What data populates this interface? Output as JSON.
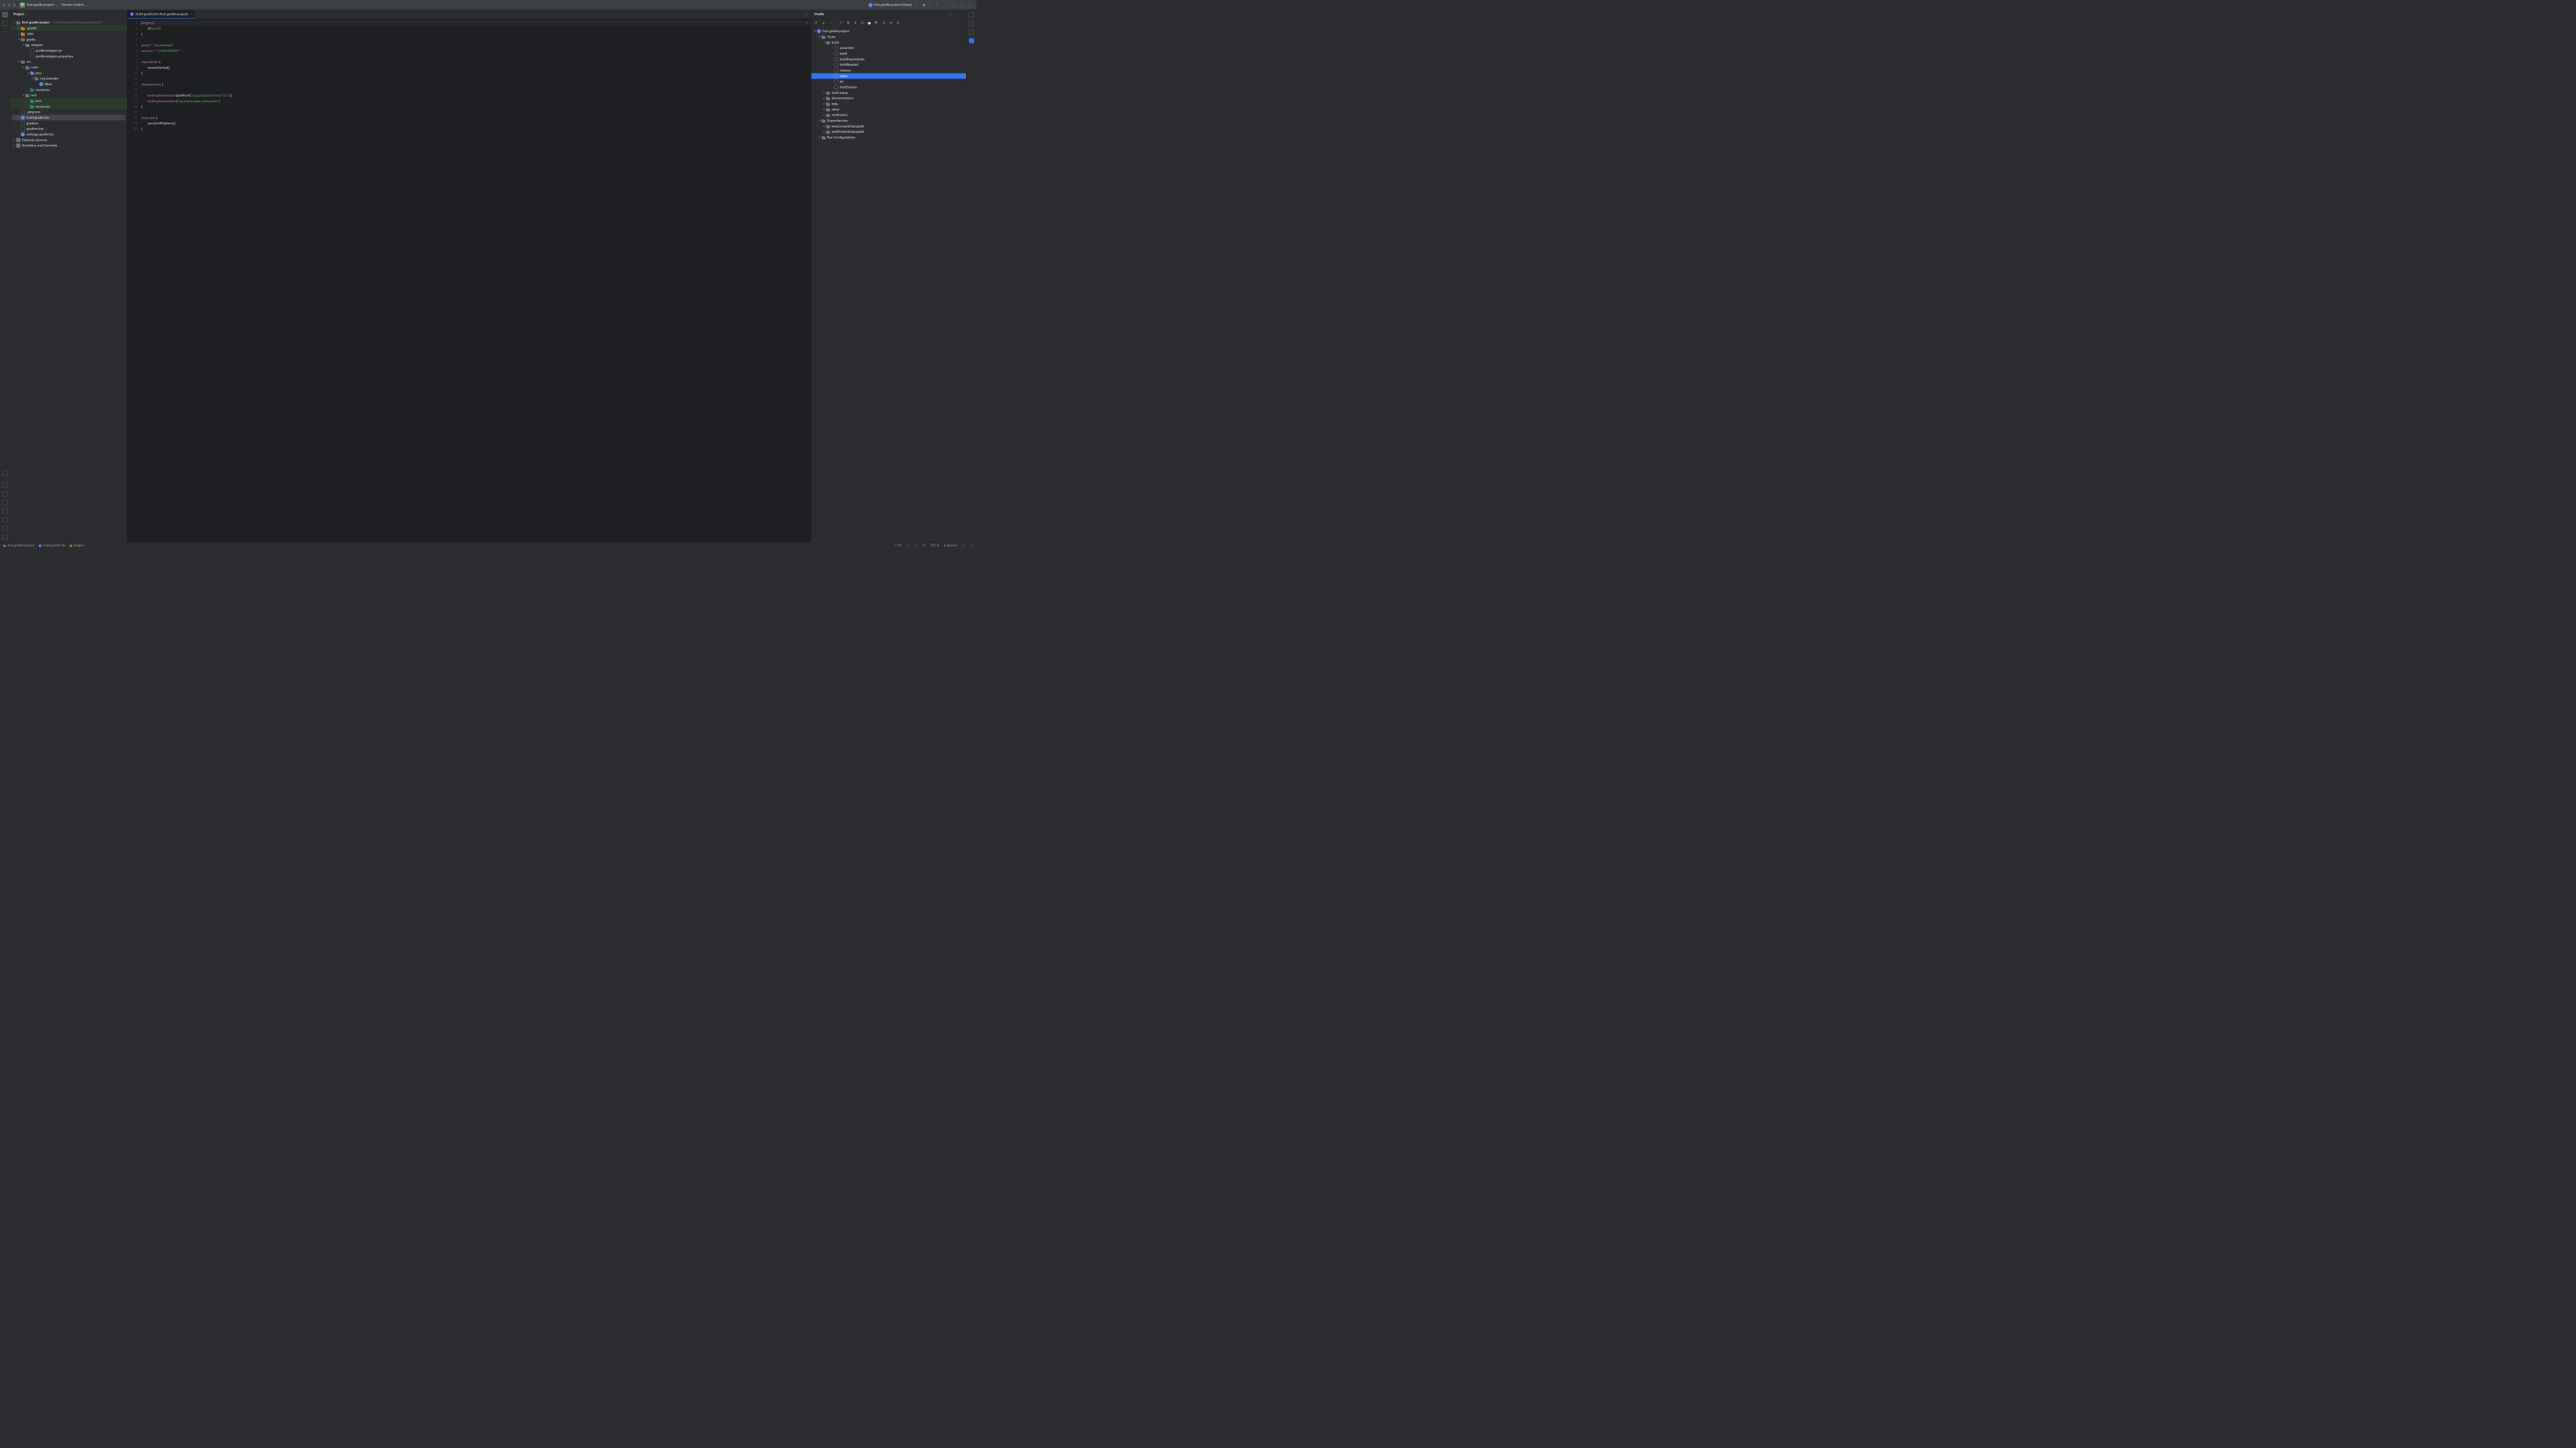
{
  "titlebar": {
    "project_badge": "FP",
    "project_name": "first-gradle-project",
    "vcs_label": "Version control",
    "run_config": "first-gradle-project [clean]"
  },
  "project_panel": {
    "title": "Project",
    "tree": {
      "root": {
        "name": "first-gradle-project",
        "path": "~/IdeaProjects/first-gradle-project"
      },
      "gradle_hidden": ".gradle",
      "idea_hidden": ".idea",
      "gradle_dir": "gradle",
      "wrapper": "wrapper",
      "wrapper_jar": "gradle-wrapper.jar",
      "wrapper_props": "gradle-wrapper.properties",
      "src": "src",
      "main": "main",
      "java_main": "java",
      "package": "org.example",
      "main_class": "Main",
      "resources_main": "resources",
      "test": "test",
      "java_test": "java",
      "resources_test": "resources",
      "gitignore": ".gitignore",
      "build_gradle": "build.gradle.kts",
      "gradlew": "gradlew",
      "gradlew_bat": "gradlew.bat",
      "settings_gradle": "settings.gradle.kts",
      "ext_libs": "External Libraries",
      "scratches": "Scratches and Consoles"
    }
  },
  "editor": {
    "tab_label": "build.gradle.kts (first-gradle-project)",
    "lines": [
      {
        "n": 1,
        "tokens": [
          {
            "t": "plugins",
            "c": "fn2"
          },
          {
            "t": " "
          },
          {
            "t": "{",
            "c": "brace"
          }
        ]
      },
      {
        "n": 2,
        "indent": 2,
        "tokens": [
          {
            "t": "id(",
            "c": ""
          },
          {
            "t": "\"java\"",
            "c": "str"
          },
          {
            "t": ")",
            "c": ""
          }
        ]
      },
      {
        "n": 3,
        "tokens": [
          {
            "t": "}",
            "c": "brace"
          }
        ]
      },
      {
        "n": 4,
        "tokens": []
      },
      {
        "n": 5,
        "tokens": [
          {
            "t": "group",
            "c": "fn2"
          },
          {
            "t": " = "
          },
          {
            "t": "\"org.example\"",
            "c": "str"
          }
        ]
      },
      {
        "n": 6,
        "tokens": [
          {
            "t": "version",
            "c": "fn2"
          },
          {
            "t": " = "
          },
          {
            "t": "\"1.0-SNAPSHOT\"",
            "c": "str"
          }
        ]
      },
      {
        "n": 7,
        "tokens": []
      },
      {
        "n": 8,
        "tokens": [
          {
            "t": "repositories",
            "c": "fn2"
          },
          {
            "t": " "
          },
          {
            "t": "{",
            "c": "brace"
          }
        ]
      },
      {
        "n": 9,
        "indent": 2,
        "tokens": [
          {
            "t": "mavenCentral()",
            "c": ""
          }
        ]
      },
      {
        "n": 10,
        "tokens": [
          {
            "t": "}",
            "c": "brace"
          }
        ]
      },
      {
        "n": 11,
        "tokens": []
      },
      {
        "n": 12,
        "tokens": [
          {
            "t": "dependencies",
            "c": "fn2"
          },
          {
            "t": " "
          },
          {
            "t": "{",
            "c": "brace"
          }
        ]
      },
      {
        "n": 13,
        "tokens": []
      },
      {
        "n": 14,
        "indent": 2,
        "tokens": [
          {
            "t": "testImplementation",
            "c": "fn"
          },
          {
            "t": "(platform("
          },
          {
            "t": "\"org.junit:junit-bom:5.10.3\"",
            "c": "str"
          },
          {
            "t": "))"
          }
        ]
      },
      {
        "n": 15,
        "indent": 2,
        "tokens": [
          {
            "t": "testImplementation",
            "c": "fn"
          },
          {
            "t": "("
          },
          {
            "t": "\"org.junit.jupiter:junit-jupiter\"",
            "c": "str"
          },
          {
            "t": ")"
          }
        ]
      },
      {
        "n": 16,
        "tokens": [
          {
            "t": "}",
            "c": "brace"
          }
        ]
      },
      {
        "n": 17,
        "tokens": []
      },
      {
        "n": 18,
        "tokens": [
          {
            "t": "tasks",
            "c": "fn2"
          },
          {
            "t": "."
          },
          {
            "t": "test",
            "c": "fn2"
          },
          {
            "t": " "
          },
          {
            "t": "{",
            "c": "brace"
          }
        ]
      },
      {
        "n": 19,
        "indent": 2,
        "tokens": [
          {
            "t": "useJUnitPlatform()",
            "c": ""
          }
        ]
      },
      {
        "n": 20,
        "tokens": [
          {
            "t": "}",
            "c": "brace"
          }
        ]
      }
    ]
  },
  "gradle_panel": {
    "title": "Gradle",
    "root": "first-gradle-project",
    "tasks": "Tasks",
    "build_group": "build",
    "build_tasks": [
      "assemble",
      "build",
      "buildDependents",
      "buildNeeded",
      "classes",
      "clean",
      "jar",
      "testClasses"
    ],
    "groups": [
      "build setup",
      "documentation",
      "help",
      "other",
      "verification"
    ],
    "dependencies": "Dependencies",
    "dep_items": [
      "testCompileClasspath",
      "testRuntimeClasspath"
    ],
    "run_configs": "Run Configurations",
    "selected_task": "clean"
  },
  "statusbar": {
    "crumb1": "first-gradle-project",
    "crumb2": "build.gradle.kts",
    "crumb3": "plugins",
    "position": "1:10",
    "line_sep": "LF",
    "encoding": "UTF-8",
    "indent": "4 spaces"
  }
}
